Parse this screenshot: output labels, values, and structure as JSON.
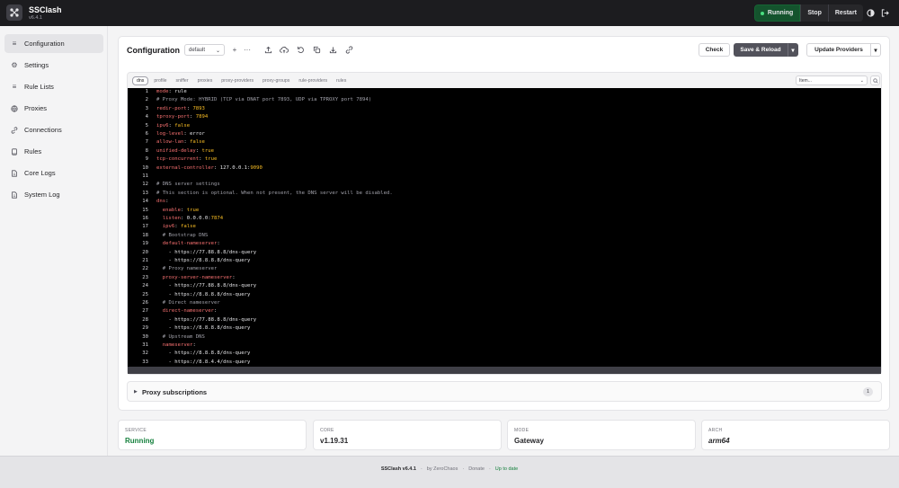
{
  "app": {
    "name": "SSClash",
    "version": "v6.4.1"
  },
  "topbar": {
    "status": "Running",
    "stop": "Stop",
    "restart": "Restart",
    "theme_icon": "contrast-icon",
    "logout_icon": "logout-icon"
  },
  "sidebar": {
    "items": [
      {
        "label": "Configuration",
        "icon": "list-icon"
      },
      {
        "label": "Settings",
        "icon": "gear-icon"
      },
      {
        "label": "Rule Lists",
        "icon": "list-icon"
      },
      {
        "label": "Proxies",
        "icon": "globe-icon"
      },
      {
        "label": "Connections",
        "icon": "link-icon"
      },
      {
        "label": "Rules",
        "icon": "book-icon"
      },
      {
        "label": "Core Logs",
        "icon": "file-icon"
      },
      {
        "label": "System Log",
        "icon": "file-icon"
      }
    ]
  },
  "config": {
    "title": "Configuration",
    "profile_value": "default",
    "add": "+",
    "more": "···",
    "check": "Check",
    "save_reload": "Save & Reload",
    "update_providers": "Update Providers",
    "tabs": [
      "dns",
      "profile",
      "sniffer",
      "proxies",
      "proxy-providers",
      "proxy-groups",
      "rule-providers",
      "rules"
    ],
    "item_placeholder": "Item..."
  },
  "code_lines": [
    "mode: rule",
    "# Proxy Mode: HYBRID (TCP via DNAT port 7893, UDP via TPROXY port 7894)",
    "redir-port: 7893",
    "tproxy-port: 7894",
    "ipv6: false",
    "log-level: error",
    "allow-lan: false",
    "unified-delay: true",
    "tcp-concurrent: true",
    "external-controller: 127.0.0.1:9090",
    "",
    "# DNS server settings",
    "# This section is optional. When not present, the DNS server will be disabled.",
    "dns:",
    "  enable: true",
    "  listen: 0.0.0.0:7874",
    "  ipv6: false",
    "  # Bootstrap DNS",
    "  default-nameserver:",
    "    - https://77.88.8.8/dns-query",
    "    - https://8.8.8.8/dns-query",
    "  # Proxy nameserver",
    "  proxy-server-nameserver:",
    "    - https://77.88.8.8/dns-query",
    "    - https://8.8.8.8/dns-query",
    "  # Direct nameserver",
    "  direct-nameserver:",
    "    - https://77.88.8.8/dns-query",
    "    - https://8.8.8.8/dns-query",
    "  # Upstream DNS",
    "  nameserver:",
    "    - https://8.8.8.8/dns-query",
    "    - https://8.8.4.4/dns-query",
    ""
  ],
  "subscriptions": {
    "title": "Proxy subscriptions",
    "count": "1"
  },
  "status_cards": [
    {
      "label": "SERVICE",
      "value": "Running"
    },
    {
      "label": "CORE",
      "value": "v1.19.31"
    },
    {
      "label": "MODE",
      "value": "Gateway"
    },
    {
      "label": "ARCH",
      "value": "arm64"
    }
  ],
  "footer": {
    "version": "SSClash v6.4.1",
    "by": "by ZeroChaos",
    "donate": "Donate",
    "update": "Up to date"
  },
  "colors": {
    "running_green": "#15803d",
    "code_bg": "#000000",
    "accent_key": "#f87171",
    "accent_value": "#fbbf24"
  }
}
